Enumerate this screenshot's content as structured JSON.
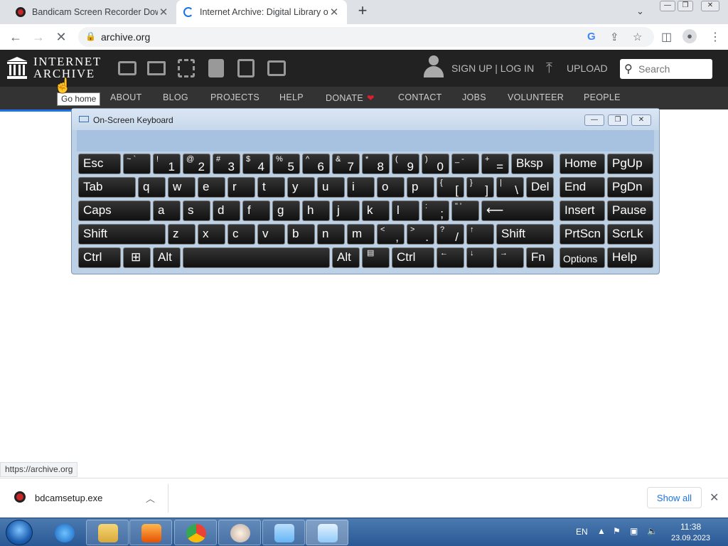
{
  "tabs": [
    {
      "title": "Bandicam Screen Recorder Down",
      "favicon": "bandicam-icon"
    },
    {
      "title": "Internet Archive: Digital Library of",
      "favicon": "loading-spinner-icon"
    }
  ],
  "address_bar": {
    "url": "archive.org"
  },
  "ia_header": {
    "logo_line1": "INTERNET",
    "logo_line2": "ARCHIVE",
    "media_icons": [
      "web-icon",
      "texts-icon",
      "video-icon",
      "audio-icon",
      "software-icon",
      "images-icon"
    ],
    "signup_label": "SIGN UP | LOG IN",
    "upload_label": "UPLOAD",
    "search_placeholder": "Search"
  },
  "ia_nav": {
    "items": [
      "ABOUT",
      "BLOG",
      "PROJECTS",
      "HELP",
      "DONATE",
      "CONTACT",
      "JOBS",
      "VOLUNTEER",
      "PEOPLE"
    ]
  },
  "tooltip": "Go home",
  "osk": {
    "title": "On-Screen Keyboard",
    "keys": {
      "esc": "Esc",
      "bksp": "Bksp",
      "home": "Home",
      "pgup": "PgUp",
      "tab": "Tab",
      "del": "Del",
      "end": "End",
      "pgdn": "PgDn",
      "caps": "Caps",
      "insert": "Insert",
      "pause": "Pause",
      "shift": "Shift",
      "prtscn": "PrtScn",
      "scrlk": "ScrLk",
      "ctrl": "Ctrl",
      "alt": "Alt",
      "fn": "Fn",
      "options": "Options",
      "help": "Help"
    }
  },
  "status_url": "https://archive.org",
  "download": {
    "filename": "bdcamsetup.exe",
    "show_all": "Show all"
  },
  "taskbar": {
    "language": "EN",
    "time": "11:38",
    "date": "23.09.2023"
  },
  "colors": {
    "ia_header_bg": "#222222",
    "ia_nav_bg": "#333333",
    "donate_heart": "#d9212b",
    "osk_frame": "#bcd0e6",
    "taskbar": "#2a5894"
  }
}
